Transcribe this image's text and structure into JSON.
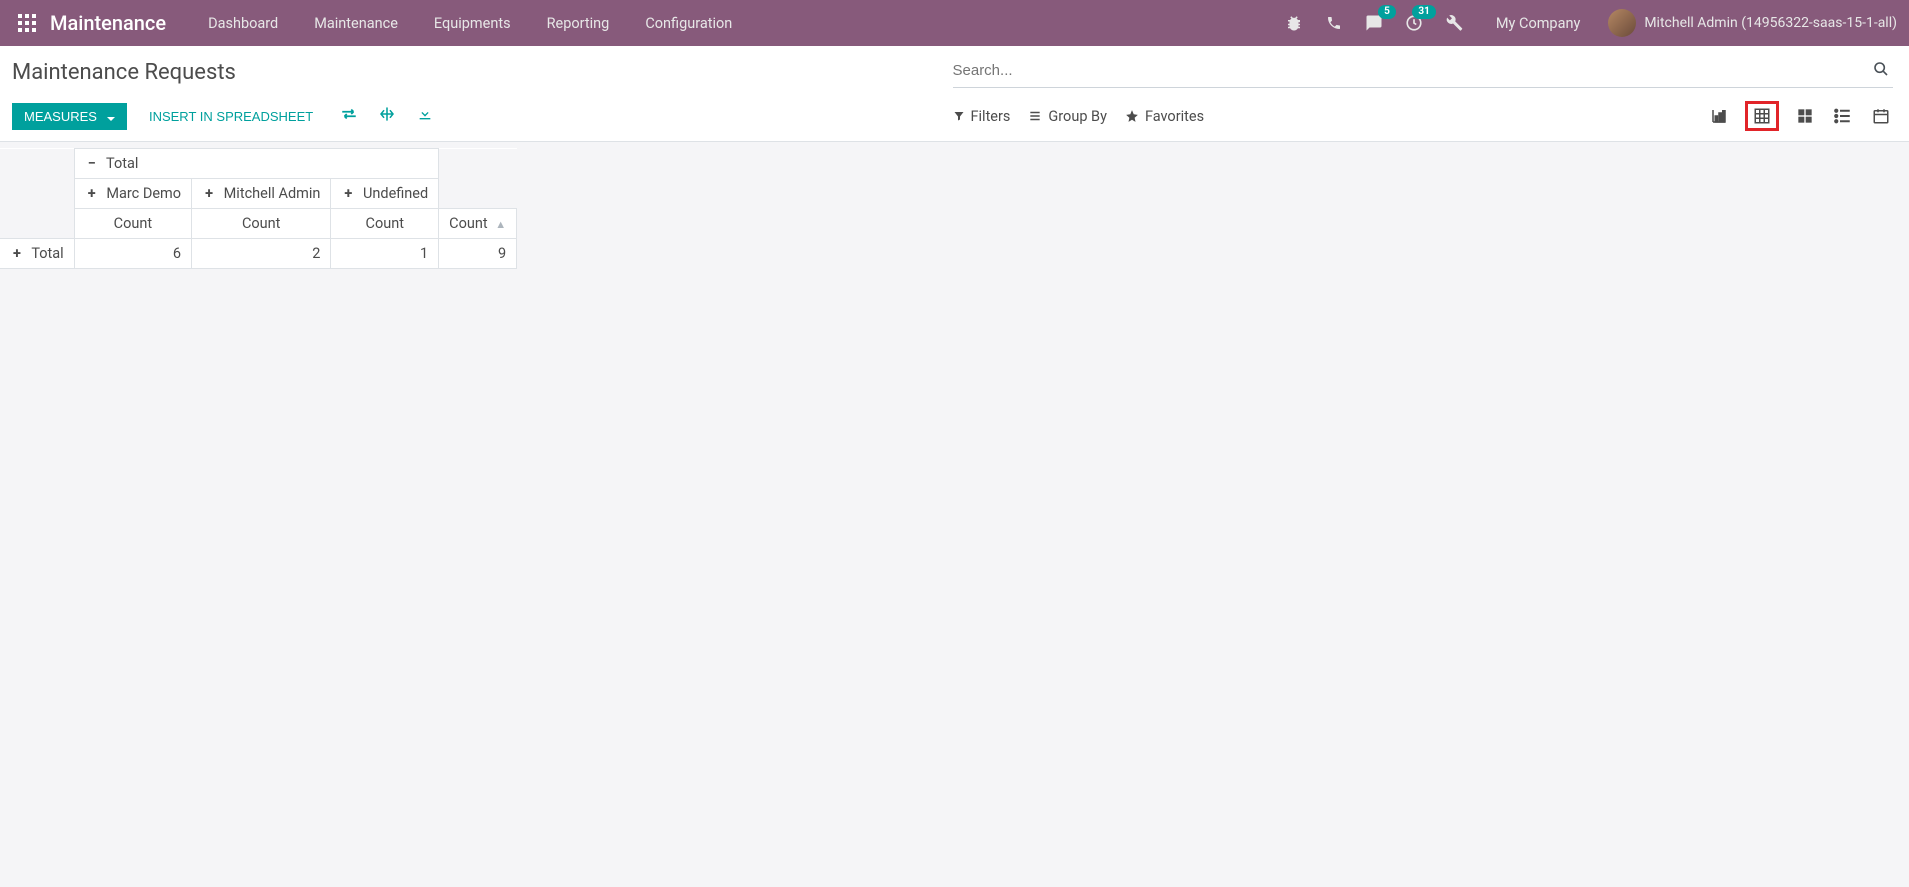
{
  "topnav": {
    "brand": "Maintenance",
    "menu": [
      "Dashboard",
      "Maintenance",
      "Equipments",
      "Reporting",
      "Configuration"
    ],
    "messages_badge": "5",
    "activities_badge": "31",
    "company": "My Company",
    "user": "Mitchell Admin (14956322-saas-15-1-all)"
  },
  "breadcrumb": "Maintenance Requests",
  "search": {
    "placeholder": "Search..."
  },
  "buttons": {
    "measures": "MEASURES",
    "insert": "INSERT IN SPREADSHEET"
  },
  "filters": {
    "filters": "Filters",
    "groupby": "Group By",
    "favorites": "Favorites"
  },
  "pivot": {
    "col_total": "Total",
    "cols": [
      "Marc Demo",
      "Mitchell Admin",
      "Undefined"
    ],
    "measure": "Count",
    "row_total": "Total",
    "values": [
      "6",
      "2",
      "1"
    ],
    "grand_total": "9"
  }
}
